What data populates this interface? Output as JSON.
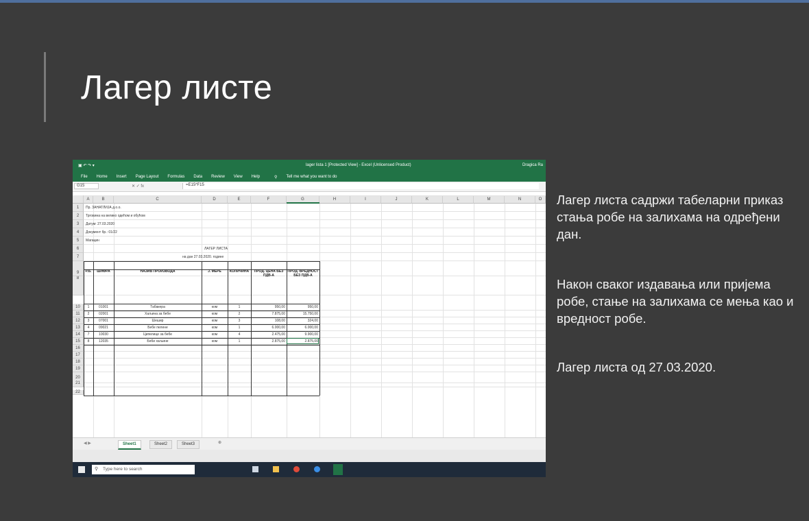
{
  "slide": {
    "title": "Лагер листе",
    "paragraphs": [
      "Лагер листа садржи табеларни приказ стања робе на залихама на одређени дан.",
      "Након сваког издавања или пријема робе, стање на залихама се мења као и вредност робе.",
      "Лагер листа од 27.03.2020."
    ],
    "colors": {
      "background": "#3b3b3b",
      "title": "#ffffff",
      "text": "#f2f2f2",
      "accent_bar": "#7a7a7a",
      "excel_green": "#217346"
    }
  },
  "excel": {
    "window_title": "lager lista 1 [Protected View] - Excel (Unlicensed Product)",
    "user": "Dragica Ra",
    "ribbon_tabs": [
      "File",
      "Home",
      "Insert",
      "Page Layout",
      "Formulas",
      "Data",
      "Review",
      "View",
      "Help"
    ],
    "tell_me": "Tell me what you want to do",
    "name_box": "G15",
    "formula_value": "=E15*F15",
    "columns": [
      "A",
      "B",
      "C",
      "D",
      "E",
      "F",
      "G",
      "H",
      "I",
      "J",
      "K",
      "L",
      "M",
      "N",
      "O"
    ],
    "rows": [
      "1",
      "2",
      "3",
      "4",
      "5",
      "6",
      "7",
      "8",
      "9",
      "10",
      "11",
      "12",
      "13",
      "14",
      "15",
      "16",
      "17",
      "18",
      "19",
      "20",
      "21",
      "22"
    ],
    "header_lines": [
      "Пр. ЗАНАТЛИЈА д.о.о.",
      "Трговина на велико одећом и обућом",
      "Датум: 27.03.2020",
      "Документ бр.: 01/22",
      "Магацин"
    ],
    "sheet_title": "ЛАГЕР ЛИСТА",
    "sheet_subtitle": "на дан 27.03.2020. године",
    "table_headers": [
      "Р.Б.",
      "ШИФРА",
      "НАЗИВ ПРОИЗВОДА",
      "Ј. МЕРЕ",
      "КОЛИЧИНА",
      "ПРОД. ЦЕНА БЕЗ ПДВ-А",
      "ПРОД. ВРЕДНОСТ БЕЗ ПДВ-А"
    ],
    "table_rows": [
      [
        "1",
        "01001",
        "Табакера",
        "ком",
        "1",
        "950,00",
        "950,00"
      ],
      [
        "2",
        "02001",
        "Хаљина за бебе",
        "ком",
        "2",
        "7.875,00",
        "15.750,00"
      ],
      [
        "3",
        "07001",
        "Шешир",
        "ком",
        "3",
        "108,00",
        "324,00"
      ],
      [
        "4",
        "09021",
        "Бебе пелене",
        "ком",
        "1",
        "6.000,00",
        "6.000,00"
      ],
      [
        "7",
        "10030",
        "Ципелице за бебе",
        "ком",
        "4",
        "2.475,00",
        "9.900,00"
      ],
      [
        "8",
        "12035",
        "Беби хаљине",
        "ком",
        "1",
        "2.875,00",
        "2.875,00"
      ]
    ],
    "sheets": [
      "Sheet1",
      "Sheet2",
      "Sheet3"
    ],
    "active_sheet": "Sheet1",
    "taskbar_search": "Type here to search"
  }
}
